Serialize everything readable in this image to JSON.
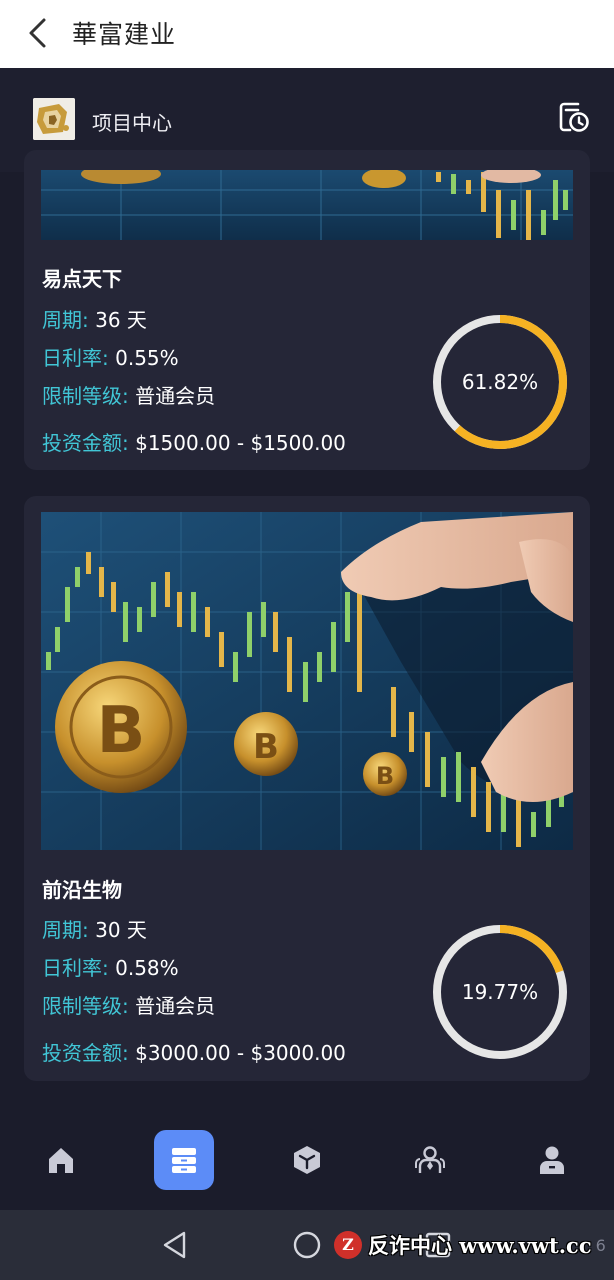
{
  "titlebar": {
    "title": "華富建业",
    "back_icon": "chevron-left-icon"
  },
  "header": {
    "title": "项目中心",
    "logo_icon": "app-logo-icon",
    "history_icon": "history-icon"
  },
  "labels": {
    "cycle": "周期:",
    "daily_rate": "日利率:",
    "level": "限制等级:",
    "amount": "投资金额:"
  },
  "projects": [
    {
      "name": "易点天下",
      "cycle": "36 天",
      "daily_rate": "0.55%",
      "level": "普通会员",
      "amount": "$1500.00 - $1500.00",
      "progress": "61.82%",
      "progress_value": 61.82
    },
    {
      "name": "前沿生物",
      "cycle": "30 天",
      "daily_rate": "0.58%",
      "level": "普通会员",
      "amount": "$3000.00 - $3000.00",
      "progress": "19.77%",
      "progress_value": 19.77
    }
  ],
  "tabbar": {
    "items": [
      "home-icon",
      "projects-icon",
      "cube-icon",
      "team-icon",
      "profile-icon"
    ],
    "active_index": 1
  },
  "system_nav": [
    "back-triangle-icon",
    "home-circle-icon",
    "recents-square-icon"
  ],
  "watermark": {
    "logo": "Z",
    "text": "反诈中心 www.vwt.cc",
    "suffix": "6"
  },
  "colors": {
    "background": "#1b1c2b",
    "card": "#252637",
    "accent_teal": "#41c6d6",
    "ring_progress": "#f5b223",
    "ring_track": "#e6e6e6",
    "active_tab": "#5c8cf7"
  }
}
